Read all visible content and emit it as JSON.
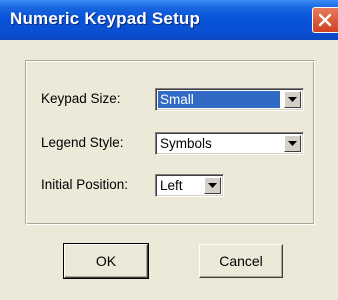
{
  "window": {
    "title": "Numeric Keypad Setup",
    "close_icon": "close-icon"
  },
  "form": {
    "keypad_size": {
      "label": "Keypad Size:",
      "value": "Small"
    },
    "legend_style": {
      "label": "Legend Style:",
      "value": "Symbols"
    },
    "initial_position": {
      "label": "Initial Position:",
      "value": "Left"
    }
  },
  "buttons": {
    "ok_label": "OK",
    "cancel_label": "Cancel"
  },
  "colors": {
    "titlebar": "#0753d8",
    "selection": "#316ac5",
    "face": "#ece9d8",
    "close": "#d0421f"
  }
}
